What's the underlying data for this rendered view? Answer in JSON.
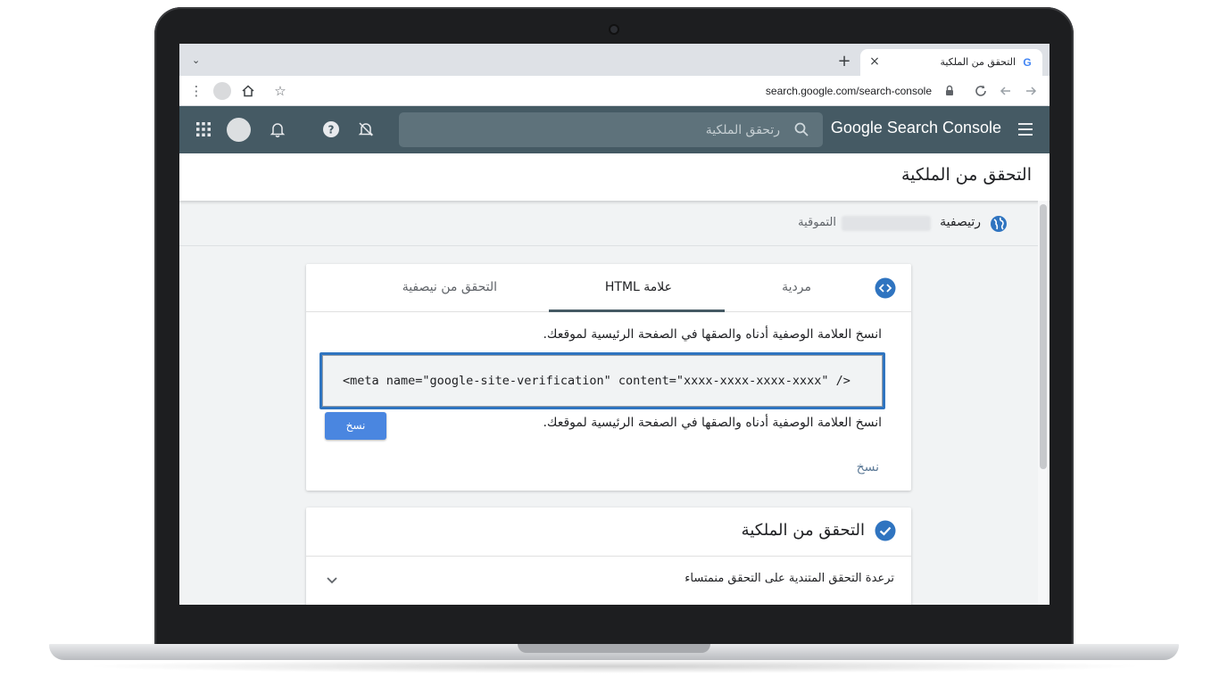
{
  "browser": {
    "tab_title": "التحقق من الملكية",
    "tab_favicon": "G",
    "tab_close": "×",
    "new_tab": "+",
    "tab_menu": "⌄",
    "url": "search.google.com/search-console"
  },
  "header": {
    "brand": "Google Search Console",
    "search_placeholder": "رتحقق الملكية"
  },
  "page": {
    "title": "التحقق من الملكية",
    "property_label": "رتيصفية",
    "property_sub": "التموقية"
  },
  "verify_card": {
    "tabs": [
      "مردية",
      "علامة HTML",
      "التحقق من نيصفية"
    ],
    "active_tab_index": 1,
    "instruction_1": "انسخ العلامة الوصفية أدناه والصقها في الصفحة الرئيسية لموقعك.",
    "meta_tag": "<meta name=\"google-site-verification\" content=\"xxxx-xxxx-xxxx-xxxx\" />",
    "instruction_2": "انسخ العلامة الوصفية أدناه والصقها في الصفحة الرئيسية لموقعك.",
    "copy_button": "نسخ",
    "copy_link": "نسخ"
  },
  "ownership_card": {
    "title": "التحقق من الملكية",
    "row_text": "ترعدة التحقق المتندية على التحقق منمتساء"
  },
  "colors": {
    "header_bg": "#455a64",
    "accent_blue": "#2f74c0",
    "button_blue": "#4a86e0",
    "content_bg": "#f1f3f4"
  },
  "icons": {
    "apps": "apps-grid-icon",
    "bell": "bell-icon",
    "help": "help-icon",
    "notifications_off": "bell-off-icon",
    "search": "search-icon",
    "menu": "hamburger-icon",
    "globe": "globe-icon",
    "code": "code-icon",
    "verified": "check-circle-icon",
    "expand": "chevron-down-icon"
  }
}
